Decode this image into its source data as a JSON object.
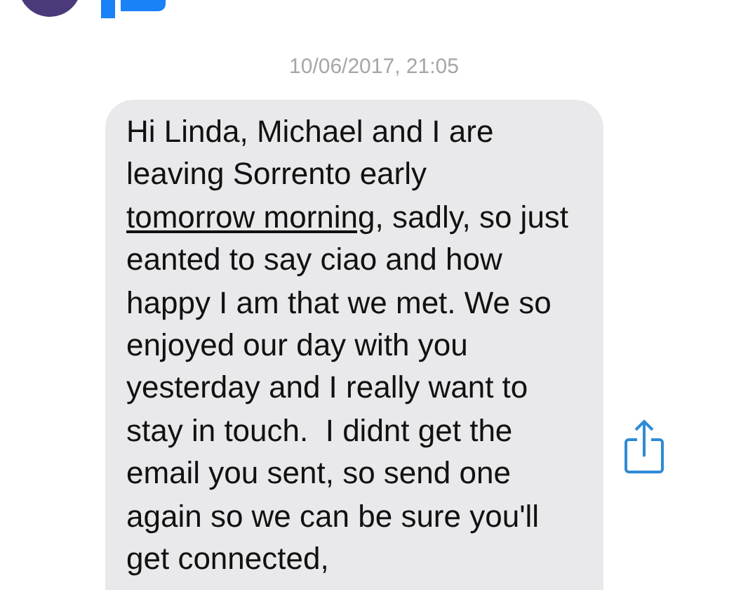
{
  "timestamp": "10/06/2017, 21:05",
  "message": {
    "segments": [
      {
        "kind": "plain",
        "text": "Hi Linda, Michael and I are leaving Sorrento early "
      },
      {
        "kind": "link",
        "text": "tomorrow morning"
      },
      {
        "kind": "plain",
        "text": ", sadly, so just eanted to say ciao and how happy I am that we met. We so enjoyed our day with you yesterday and I really want to stay in touch.  I didnt get the email you sent, so send one again so we can be sure you'll get connected,"
      }
    ]
  }
}
